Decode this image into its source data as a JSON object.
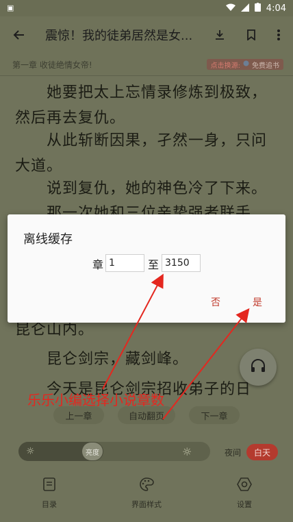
{
  "status_bar": {
    "left_icon": "notification-icon",
    "time": "4:04"
  },
  "toolbar": {
    "title": "震惊！我的徒弟居然是女..."
  },
  "chapter": {
    "title": "第一章 收徒绝情女帝!",
    "source_label": "点击换源:",
    "source_name": "免费追书"
  },
  "reading": {
    "paragraphs": [
      "　　她要把太上忘情录修炼到极致，然后再去复仇。",
      "　　从此斩断因果，孑然一身，只问大道。",
      "　　说到复仇，她的神色冷了下来。",
      "　　那一次她和三位亲挚强者联手..."
    ],
    "lines_below": [
      "昆仑山内。",
      "　　昆仑剑宗，藏剑峰。",
      "　　今天是昆仑剑宗招收弟子的日"
    ]
  },
  "dialog": {
    "title": "离线缓存",
    "from_label": "章",
    "from_value": "1",
    "to_label": "至",
    "to_value": "3150",
    "cancel_label": "否",
    "confirm_label": "是"
  },
  "controls": {
    "prev_chapter": "上一章",
    "auto_page": "自动翻页",
    "next_chapter": "下一章",
    "brightness_label": "亮度",
    "brightness_level": 0.36,
    "night_label": "夜间",
    "day_label": "白天"
  },
  "tabs": [
    {
      "label": "目录",
      "icon": "toc-icon"
    },
    {
      "label": "界面样式",
      "icon": "palette-icon"
    },
    {
      "label": "设置",
      "icon": "settings-icon"
    }
  ],
  "annotation": {
    "text": "乐乐小编选择小说章数",
    "color": "#e4271f"
  }
}
